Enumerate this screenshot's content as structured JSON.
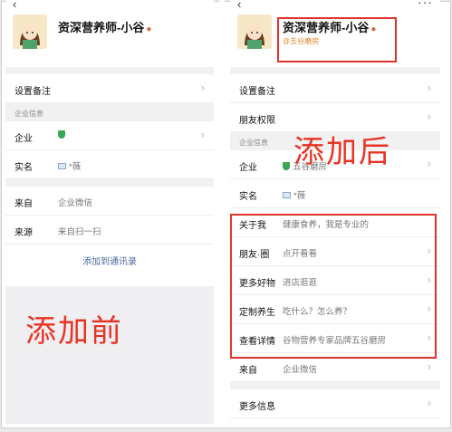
{
  "before": {
    "title": "资深营养师-小谷",
    "rows_top": [
      {
        "label": "设置备注",
        "value": "",
        "chevron": true
      }
    ],
    "section_header": "企业信息",
    "company_rows": [
      {
        "label": "企业",
        "value": "",
        "icon": "green-shield-icon",
        "chevron": true
      },
      {
        "label": "实名",
        "value": "*薇",
        "icon": "id-card-icon",
        "chevron": false
      }
    ],
    "source_rows": [
      {
        "label": "来自",
        "value": "企业微信",
        "chevron": false
      },
      {
        "label": "来源",
        "value": "来自扫一扫",
        "chevron": false
      }
    ],
    "add_link": "添加到通讯录",
    "caption": "添加前"
  },
  "after": {
    "title": "资深营养师-小谷",
    "subtitle": "@五谷磨房",
    "rows_top": [
      {
        "label": "设置备注",
        "value": "",
        "chevron": true
      },
      {
        "label": "朋友权限",
        "value": "",
        "chevron": true
      }
    ],
    "section_header": "企业信息",
    "company_rows": [
      {
        "label": "企业",
        "value": "五谷磨房",
        "icon": "green-shield-icon",
        "chevron": true
      },
      {
        "label": "实名",
        "value": "*薇",
        "icon": "id-card-icon",
        "chevron": false
      }
    ],
    "custom_rows": [
      {
        "label": "关于我",
        "value": "健康食养，我是专业的",
        "chevron": false
      },
      {
        "label": "朋友·圈",
        "value": "点开看看",
        "chevron": true
      },
      {
        "label": "更多好物",
        "value": "进店逛逛",
        "chevron": true
      },
      {
        "label": "定制养生",
        "value": "吃什么？怎么养？",
        "chevron": true
      },
      {
        "label": "查看详情",
        "value": "谷物营养专家品牌五谷磨房",
        "chevron": true
      }
    ],
    "bottom_rows": [
      {
        "label": "来自",
        "value": "企业微信",
        "chevron": true
      },
      {
        "label": "更多信息",
        "value": "",
        "chevron": true
      }
    ],
    "caption": "添加后"
  }
}
